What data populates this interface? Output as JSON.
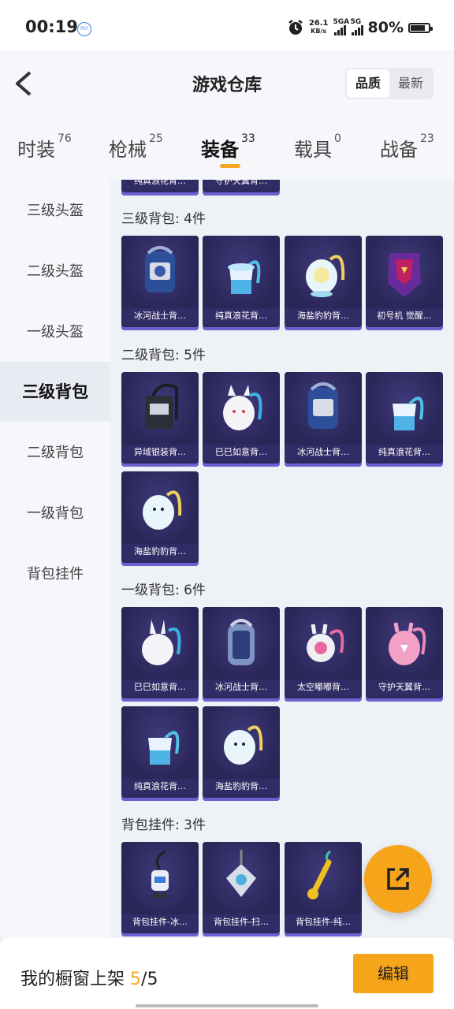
{
  "status": {
    "time": "00:19",
    "speed_value": "26.1",
    "speed_unit": "KB/s",
    "net1": "5GA",
    "net2": "5G",
    "battery": "80%"
  },
  "header": {
    "title": "游戏仓库",
    "sort_options": [
      "品质",
      "最新"
    ],
    "active_sort": "品质"
  },
  "tabs": [
    {
      "label": "时装",
      "count": "76"
    },
    {
      "label": "枪械",
      "count": "25"
    },
    {
      "label": "装备",
      "count": "33"
    },
    {
      "label": "载具",
      "count": "0"
    },
    {
      "label": "战备",
      "count": "23"
    }
  ],
  "sidebar": [
    "三级头盔",
    "二级头盔",
    "一级头盔",
    "三级背包",
    "二级背包",
    "一级背包",
    "背包挂件"
  ],
  "active_sidebar": "三级背包",
  "content": {
    "top_partial": [
      "纯真浪花背…",
      "守护天翼背…"
    ],
    "sections": [
      {
        "title": "三级背包: 4件",
        "items": [
          "冰河战士背…",
          "纯真浪花背…",
          "海盐豹豹背…",
          "初号机 觉醒…"
        ]
      },
      {
        "title": "二级背包: 5件",
        "items": [
          "异域银装背…",
          "巳巳如意背…",
          "冰河战士背…",
          "纯真浪花背…",
          "海盐豹豹背…"
        ]
      },
      {
        "title": "一级背包: 6件",
        "items": [
          "巳巳如意背…",
          "冰河战士背…",
          "太空嘟嘟背…",
          "守护天翼背…",
          "纯真浪花背…",
          "海盐豹豹背…"
        ]
      },
      {
        "title": "背包挂件: 3件",
        "items": [
          "背包挂件-冰…",
          "背包挂件-扫…",
          "背包挂件-纯…"
        ]
      }
    ]
  },
  "bottom": {
    "label": "我的橱窗上架",
    "current": "5",
    "separator": "/",
    "total": "5",
    "edit": "编辑"
  },
  "colors": {
    "accent": "#f6a41a",
    "card_bg": "#2f2a5e"
  }
}
